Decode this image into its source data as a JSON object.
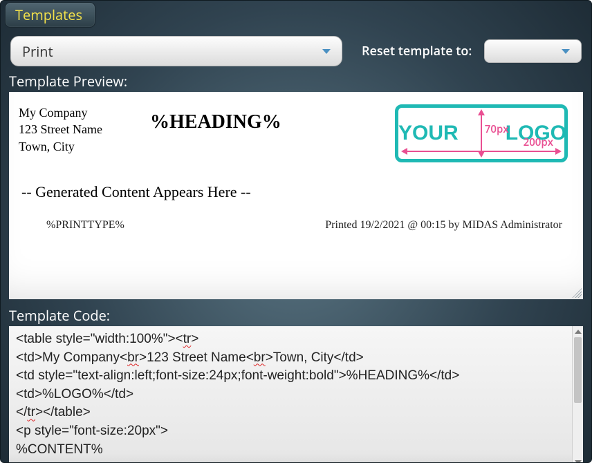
{
  "tab": {
    "label": "Templates"
  },
  "controls": {
    "template_dropdown_value": "Print",
    "reset_label": "Reset template to:",
    "reset_dropdown_value": ""
  },
  "sections": {
    "preview_label": "Template Preview:",
    "code_label": "Template Code:"
  },
  "preview": {
    "company_block": "My Company\n123 Street Name\nTown, City",
    "heading": "%HEADING%",
    "logo": {
      "word1": "YOUR",
      "word2": "LOGO",
      "dim_h_label": "200px",
      "dim_v_label": "70px"
    },
    "generated_line": "-- Generated Content Appears Here --",
    "footer_left": "%PRINTTYPE%",
    "footer_right": "Printed 19/2/2021 @ 00:15 by MIDAS Administrator"
  },
  "code": {
    "lines": [
      {
        "pre": "<table style=\"width:100%\"><",
        "squig": "tr",
        "post": ">"
      },
      {
        "pre": "<td>My Company<",
        "squig": "br",
        "mid": ">123 Street Name<",
        "squig2": "br",
        "post": ">Town, City</td>"
      },
      {
        "pre": "<td style=\"text-align:left;font-size:24px;font-weight:bold\">%HEADING%</td>"
      },
      {
        "pre": "<td>%LOGO%</td>"
      },
      {
        "pre": "</",
        "squig": "tr",
        "post": "></table>"
      },
      {
        "pre": "<p style=\"font-size:20px\">"
      },
      {
        "pre": "%CONTENT%"
      }
    ]
  }
}
